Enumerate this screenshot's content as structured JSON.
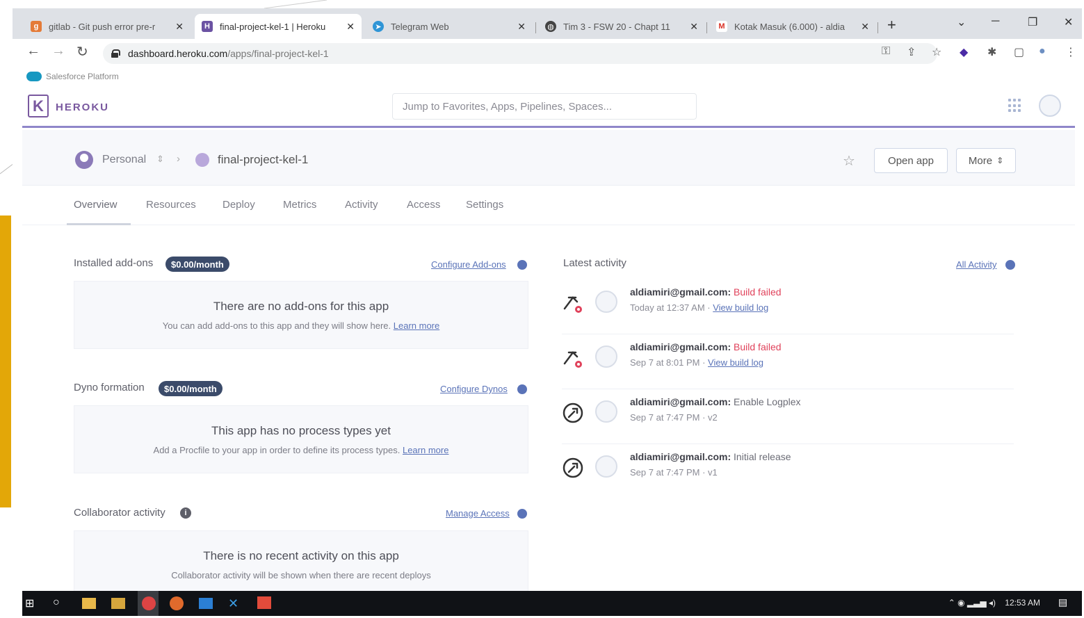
{
  "browser": {
    "tabs": [
      {
        "title": "gitlab - Git push error pre-r",
        "favicon": "gitlab-icon",
        "active": false
      },
      {
        "title": "final-project-kel-1 | Heroku",
        "favicon": "heroku-icon",
        "active": true
      },
      {
        "title": "Telegram Web",
        "favicon": "telegram-icon",
        "active": false
      },
      {
        "title": "Tim 3 - FSW 20 - Chapt 11",
        "favicon": "globe-icon",
        "active": false
      },
      {
        "title": "Kotak Masuk (6.000) - aldia",
        "favicon": "gmail-icon",
        "active": false
      }
    ],
    "url_host": "dashboard.heroku.com",
    "url_path": "/apps/final-project-kel-1",
    "bookmark": "Salesforce Platform"
  },
  "heroku": {
    "brand": "HEROKU",
    "search_placeholder": "Jump to Favorites, Apps, Pipelines, Spaces...",
    "breadcrumb": {
      "team": "Personal",
      "app": "final-project-kel-1"
    },
    "buttons": {
      "open_app": "Open app",
      "more": "More"
    },
    "nav_tabs": [
      "Overview",
      "Resources",
      "Deploy",
      "Metrics",
      "Activity",
      "Access",
      "Settings"
    ],
    "addons": {
      "title": "Installed add-ons",
      "price": "$0.00/month",
      "link": "Configure Add-ons",
      "empty_title": "There are no add-ons for this app",
      "empty_sub": "You can add add-ons to this app and they will show here.",
      "learn_more": "Learn more"
    },
    "dynos": {
      "title": "Dyno formation",
      "price": "$0.00/month",
      "link": "Configure Dynos",
      "empty_title": "This app has no process types yet",
      "empty_sub": "Add a Procfile to your app in order to define its process types.",
      "learn_more": "Learn more"
    },
    "collaborators": {
      "title": "Collaborator activity",
      "link": "Manage Access",
      "empty_title": "There is no recent activity on this app",
      "empty_sub": "Collaborator activity will be shown when there are recent deploys"
    },
    "activity": {
      "title": "Latest activity",
      "link": "All Activity",
      "items": [
        {
          "user": "aldiamiri@gmail.com:",
          "message": "Build failed",
          "status": "fail",
          "time": "Today at 12:37 AM · ",
          "link": "View build log",
          "icon": "build-failed-icon"
        },
        {
          "user": "aldiamiri@gmail.com:",
          "message": "Build failed",
          "status": "fail",
          "time": "Sep 7 at 8:01 PM · ",
          "link": "View build log",
          "icon": "build-failed-icon"
        },
        {
          "user": "aldiamiri@gmail.com:",
          "message": "Enable Logplex",
          "status": "ok",
          "time": "Sep 7 at 7:47 PM · v2",
          "link": "",
          "icon": "release-icon"
        },
        {
          "user": "aldiamiri@gmail.com:",
          "message": "Initial release",
          "status": "ok",
          "time": "Sep 7 at 7:47 PM · v1",
          "link": "",
          "icon": "release-icon"
        }
      ]
    }
  },
  "taskbar": {
    "time": "12:53 AM"
  },
  "colors": {
    "heroku_purple": "#79589f",
    "fail_red": "#e0425b",
    "link_blue": "#5a73b8",
    "pill_bg": "#3b4b6a",
    "accent_yellow": "#e3a708"
  }
}
